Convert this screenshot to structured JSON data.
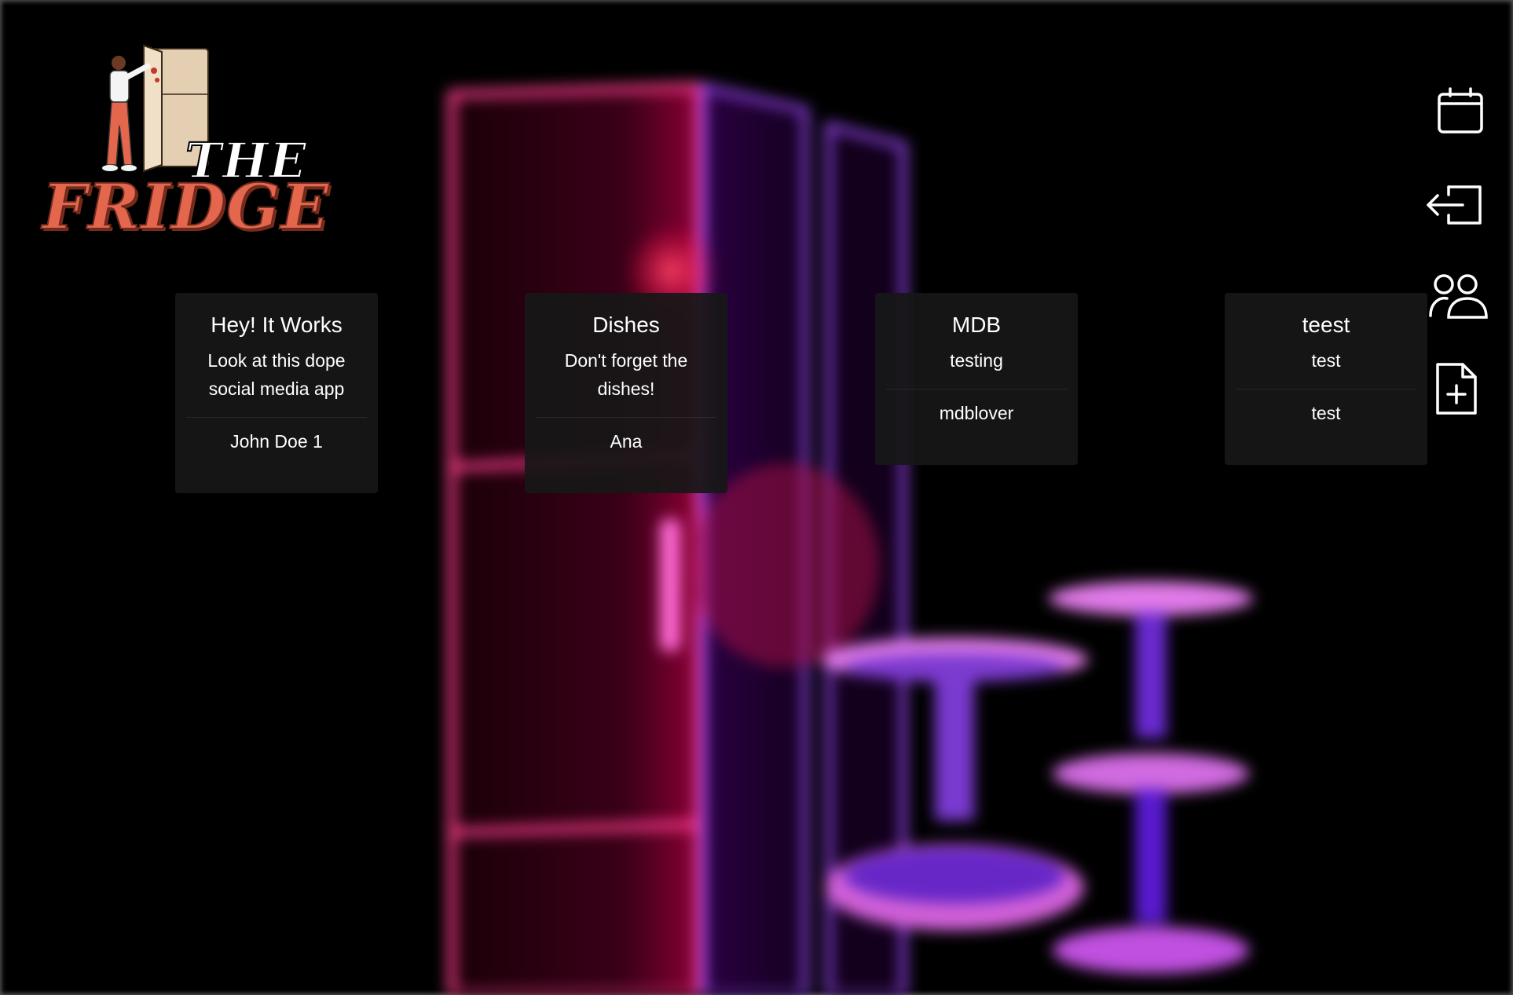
{
  "app": {
    "logo_text_top": "THE",
    "logo_text_bottom": "FRIDGE"
  },
  "posts": [
    {
      "title": "Hey! It Works",
      "body": "Look at this dope social media app",
      "author": "John Doe 1"
    },
    {
      "title": "Dishes",
      "body": "Don't forget the dishes!",
      "author": "Ana"
    },
    {
      "title": "MDB",
      "body": "testing",
      "author": "mdblover"
    },
    {
      "title": "teest",
      "body": "test",
      "author": "test"
    }
  ],
  "nav": {
    "items": [
      {
        "icon": "calendar-icon"
      },
      {
        "icon": "logout-icon"
      },
      {
        "icon": "users-icon"
      },
      {
        "icon": "new-post-icon"
      }
    ]
  },
  "colors": {
    "background": "#000000",
    "card": "#171717",
    "logo_accent": "#e4674d",
    "neon_pink": "#ff3f8f",
    "neon_purple": "#b44cff"
  }
}
